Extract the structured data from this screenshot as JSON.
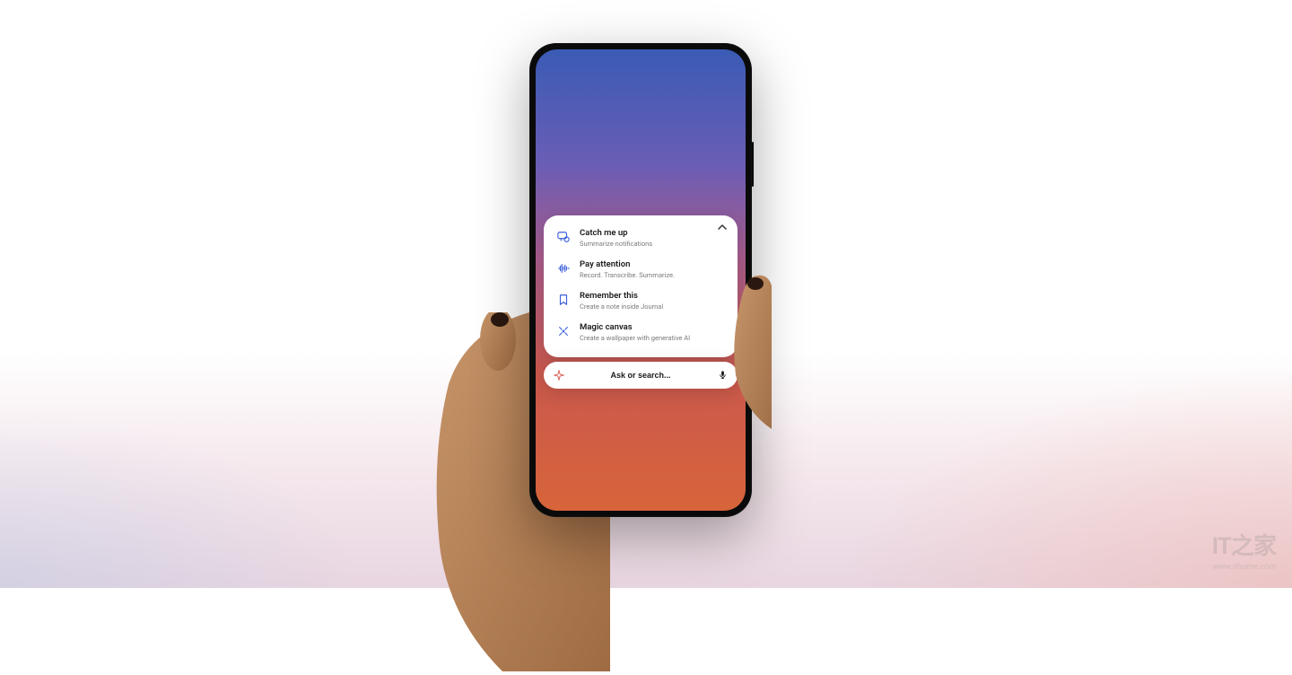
{
  "actions": [
    {
      "title": "Catch me up",
      "subtitle": "Summarize notifications",
      "icon": "chat-icon"
    },
    {
      "title": "Pay attention",
      "subtitle": "Record. Transcribe. Summarize.",
      "icon": "soundwave-icon"
    },
    {
      "title": "Remember this",
      "subtitle": "Create a note inside Journal",
      "icon": "bookmark-icon"
    },
    {
      "title": "Magic canvas",
      "subtitle": "Create a wallpaper with generative AI",
      "icon": "sparkle-icon"
    }
  ],
  "search": {
    "placeholder": "Ask or search..."
  },
  "watermark": {
    "logo": "IT之家",
    "url": "www.ithome.com"
  },
  "colors": {
    "accent": "#3b5fd9",
    "accent2": "#d9544a"
  }
}
